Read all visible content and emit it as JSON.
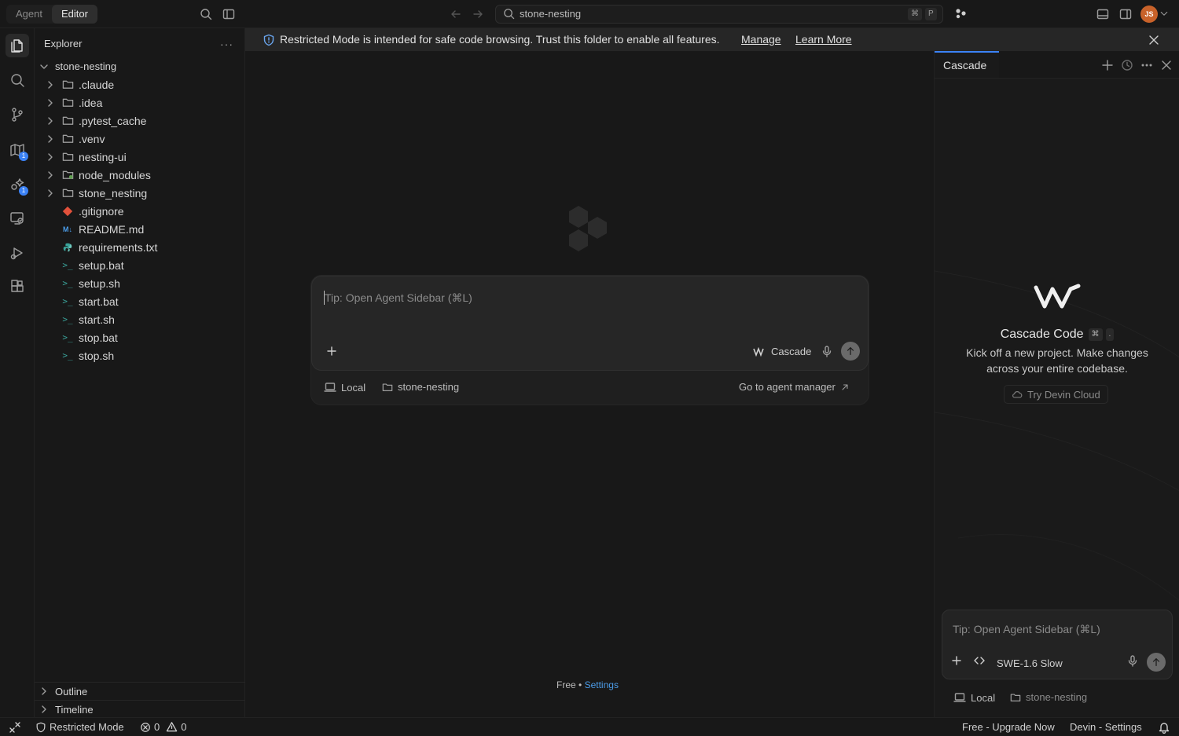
{
  "titlebar": {
    "mode_tabs": [
      "Agent",
      "Editor"
    ],
    "active_mode": "Editor",
    "command_center": "stone-nesting",
    "shortcut_keys": [
      "⌘",
      "P"
    ],
    "avatar_initials": "JS"
  },
  "activity_bar": {
    "items": [
      "explorer-icon",
      "search-icon",
      "source-control-icon",
      "map-icon",
      "extensions-ai-icon",
      "remote-icon",
      "run-debug-icon",
      "extensions-icon"
    ],
    "badges": {
      "map": "1",
      "extensions_ai": "1"
    }
  },
  "explorer": {
    "title": "Explorer",
    "more": "···",
    "root": "stone-nesting",
    "items": [
      {
        "label": ".claude",
        "type": "folder"
      },
      {
        "label": ".idea",
        "type": "folder"
      },
      {
        "label": ".pytest_cache",
        "type": "folder"
      },
      {
        "label": ".venv",
        "type": "folder"
      },
      {
        "label": "nesting-ui",
        "type": "folder"
      },
      {
        "label": "node_modules",
        "type": "folder"
      },
      {
        "label": "stone_nesting",
        "type": "folder"
      },
      {
        "label": ".gitignore",
        "type": "git"
      },
      {
        "label": "README.md",
        "type": "markdown"
      },
      {
        "label": "requirements.txt",
        "type": "python"
      },
      {
        "label": "setup.bat",
        "type": "shell"
      },
      {
        "label": "setup.sh",
        "type": "shell"
      },
      {
        "label": "start.bat",
        "type": "shell"
      },
      {
        "label": "start.sh",
        "type": "shell"
      },
      {
        "label": "stop.bat",
        "type": "shell"
      },
      {
        "label": "stop.sh",
        "type": "shell"
      }
    ],
    "sections": [
      "Outline",
      "Timeline"
    ]
  },
  "banner": {
    "message": "Restricted Mode is intended for safe code browsing. Trust this folder to enable all features.",
    "manage": "Manage",
    "learn_more": "Learn More"
  },
  "editor": {
    "chat_placeholder": "Tip: Open Agent Sidebar (⌘L)",
    "model": "Cascade",
    "local": "Local",
    "folder": "stone-nesting",
    "agent_manager": "Go to agent manager",
    "footer_free": "Free",
    "footer_sep": "•",
    "footer_settings": "Settings"
  },
  "cascade": {
    "tab": "Cascade",
    "title": "Cascade Code",
    "shortcut": [
      "⌘",
      "."
    ],
    "subtitle": "Kick off a new project. Make changes across your entire codebase.",
    "try_devin": "Try Devin Cloud",
    "input_placeholder": "Tip: Open Agent Sidebar (⌘L)",
    "model": "SWE-1.6 Slow",
    "local": "Local",
    "folder": "stone-nesting"
  },
  "statusbar": {
    "restricted": "Restricted Mode",
    "errors": "0",
    "warnings": "0",
    "upgrade": "Free - Upgrade Now",
    "devin_settings": "Devin - Settings"
  },
  "colors": {
    "accent": "#3b82f6",
    "link": "#4b9ce8",
    "avatar": "#c8622a"
  }
}
